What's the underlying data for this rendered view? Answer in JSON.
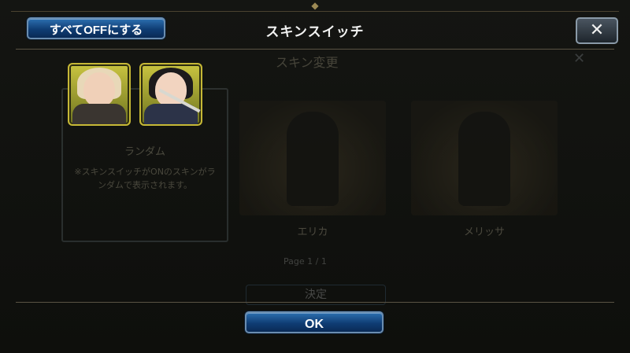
{
  "header": {
    "title": "スキンスイッチ",
    "all_off_label": "すべてOFFにする",
    "close_label": "✕"
  },
  "background_dialog": {
    "title": "スキン変更",
    "close_label": "✕",
    "random": {
      "label": "ランダム",
      "note": "※スキンスイッチがONのスキンがランダムで表示されます。"
    },
    "skins": [
      {
        "name": "エリカ"
      },
      {
        "name": "メリッサ"
      }
    ],
    "page_indicator": "Page 1 / 1",
    "confirm_label": "決定"
  },
  "selected_skins": [
    {
      "character": "melissa",
      "icon": "character-portrait"
    },
    {
      "character": "erika",
      "icon": "character-portrait"
    }
  ],
  "footer": {
    "ok_label": "OK"
  },
  "colors": {
    "button_blue": "#0f3d74",
    "frame_gold": "#c6b836",
    "background": "#0e0f0c"
  }
}
